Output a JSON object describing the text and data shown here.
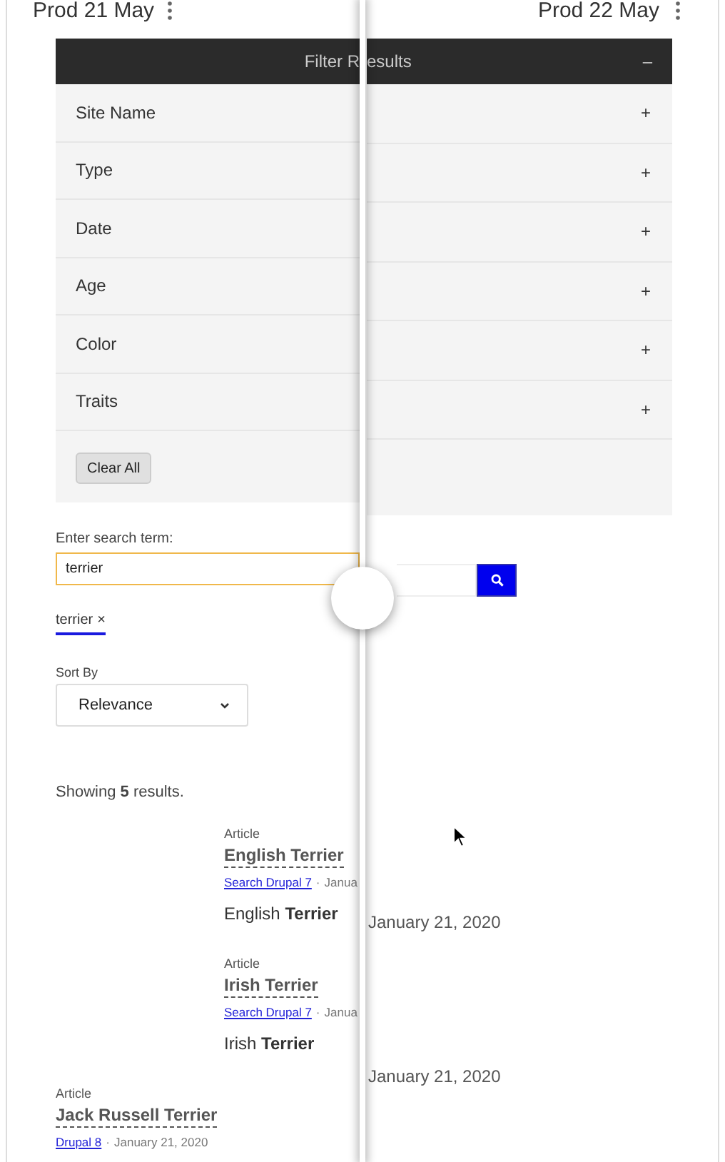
{
  "left_pane": {
    "version": "Prod 21 May",
    "filter_title": "Filter R",
    "filters": [
      "Site Name",
      "Type",
      "Date",
      "Age",
      "Color",
      "Traits"
    ],
    "clear_button": "Clear All",
    "search_label": "Enter search term:",
    "search_value": "terrier",
    "search_focused": true,
    "chip": {
      "text": "terrier",
      "remove": "×"
    },
    "sort": {
      "label": "Sort By",
      "value": "Relevance"
    },
    "summary": "Showing **5** results.",
    "results": [
      {
        "type": "Article",
        "title": "English Terrier",
        "source": "Search Drupal 7",
        "separator": "·",
        "date": "Janua",
        "snippet": "English **Terrier**",
        "indented": true
      },
      {
        "type": "Article",
        "title": "Irish Terrier",
        "source": "Search Drupal 7",
        "separator": "·",
        "date": "Janua",
        "snippet": "Irish **Terrier**",
        "indented": true
      },
      {
        "type": "Article",
        "title": "Jack Russell Terrier",
        "source": "Drupal 8",
        "separator": "·",
        "date": "January 21, 2020",
        "indented": false
      }
    ]
  },
  "right_pane": {
    "version": "Prod 22 May",
    "filter_title": "esults",
    "collapse": "–",
    "toggles": [
      "+",
      "+",
      "+",
      "+",
      "+",
      "+"
    ],
    "dates": [
      "January 21, 2020",
      "January 21, 2020"
    ]
  }
}
